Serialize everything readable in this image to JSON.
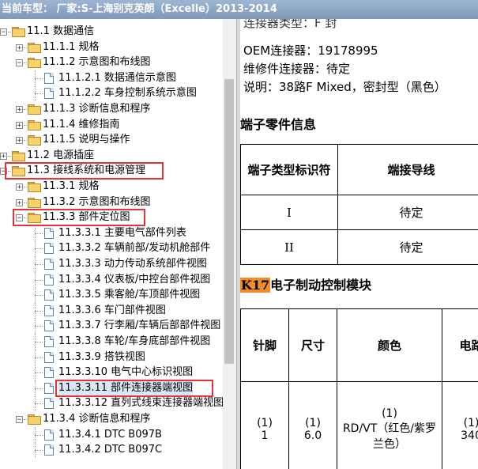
{
  "window": {
    "title": "当前车型：  厂家:S-上海别克英朗（Excelle）2013-2014"
  },
  "tree": {
    "items": [
      {
        "label": "11.1 数据通信",
        "level": 1,
        "type": "folder",
        "expander": "−"
      },
      {
        "label": "11.1.1 规格",
        "level": 2,
        "type": "folder",
        "expander": "+"
      },
      {
        "label": "11.1.2 示意图和布线图",
        "level": 2,
        "type": "folder",
        "expander": "−"
      },
      {
        "label": "11.1.2.1 数据通信示意图",
        "level": 3,
        "type": "page"
      },
      {
        "label": "11.1.2.2 车身控制系统示意图",
        "level": 3,
        "type": "page"
      },
      {
        "label": "11.1.3 诊断信息和程序",
        "level": 2,
        "type": "folder",
        "expander": "+"
      },
      {
        "label": "11.1.4 维修指南",
        "level": 2,
        "type": "folder",
        "expander": "+"
      },
      {
        "label": "11.1.5 说明与操作",
        "level": 2,
        "type": "folder",
        "expander": "+"
      },
      {
        "label": "11.2 电源插座",
        "level": 1,
        "type": "folder",
        "expander": "+"
      },
      {
        "label": "11.3 接线系统和电源管理",
        "level": 1,
        "type": "folder",
        "expander": "−"
      },
      {
        "label": "11.3.1 规格",
        "level": 2,
        "type": "folder",
        "expander": "+"
      },
      {
        "label": "11.3.2 示意图和布线图",
        "level": 2,
        "type": "folder",
        "expander": "+"
      },
      {
        "label": "11.3.3 部件定位图",
        "level": 2,
        "type": "folder",
        "expander": "−"
      },
      {
        "label": "11.3.3.1 主要电气部件列表",
        "level": 3,
        "type": "page"
      },
      {
        "label": "11.3.3.2 车辆前部/发动机舱部件",
        "level": 3,
        "type": "page"
      },
      {
        "label": "11.3.3.3 动力传动系统部件视图",
        "level": 3,
        "type": "page"
      },
      {
        "label": "11.3.3.4 仪表板/中控台部件视图",
        "level": 3,
        "type": "page"
      },
      {
        "label": "11.3.3.5 乘客舱/车顶部件视图",
        "level": 3,
        "type": "page"
      },
      {
        "label": "11.3.3.6 车门部件视图",
        "level": 3,
        "type": "page"
      },
      {
        "label": "11.3.3.7 行李厢/车辆后部部件视图",
        "level": 3,
        "type": "page"
      },
      {
        "label": "11.3.3.8 车轮/车身底部部件视图",
        "level": 3,
        "type": "page"
      },
      {
        "label": "11.3.3.9 搭铁视图",
        "level": 3,
        "type": "page"
      },
      {
        "label": "11.3.3.10 电气中心标识视图",
        "level": 3,
        "type": "page"
      },
      {
        "label": "11.3.3.11 部件连接器端视图",
        "level": 3,
        "type": "page"
      },
      {
        "label": "11.3.3.12 直列式线束连接器端视图",
        "level": 3,
        "type": "page"
      },
      {
        "label": "11.3.4 诊断信息和程序",
        "level": 2,
        "type": "folder",
        "expander": "−"
      },
      {
        "label": "11.3.4.1 DTC B097B",
        "level": 3,
        "type": "page"
      },
      {
        "label": "11.3.4.2 DTC B097C",
        "level": 3,
        "type": "page"
      }
    ]
  },
  "content": {
    "oem_line": "OEM连接器：19178995",
    "repair_line": "维修件连接器：待定",
    "desc_line": "说明：38路F Mixed，密封型（黑色）",
    "terminal_heading": "端子零件信息",
    "terminal_table": {
      "headers": [
        "端子类型标识符",
        "端接导线"
      ],
      "rows": [
        [
          "I",
          "待定"
        ],
        [
          "II",
          "待定"
        ]
      ]
    },
    "module_code": "K17",
    "module_name": "电子制动控制模块",
    "pin_table": {
      "headers": [
        "针脚",
        "尺寸",
        "颜色",
        "电路"
      ],
      "rows": [
        [
          "(1)\n1",
          "(1)\n6.0",
          "(1)\nRD/VT（红色/紫罗兰色）",
          "(1)\n340"
        ]
      ]
    }
  },
  "colors": {
    "titlebar": "#8ca6c8",
    "highlight_box": "#e4343a",
    "module_code_bg": "#f28c2a"
  }
}
